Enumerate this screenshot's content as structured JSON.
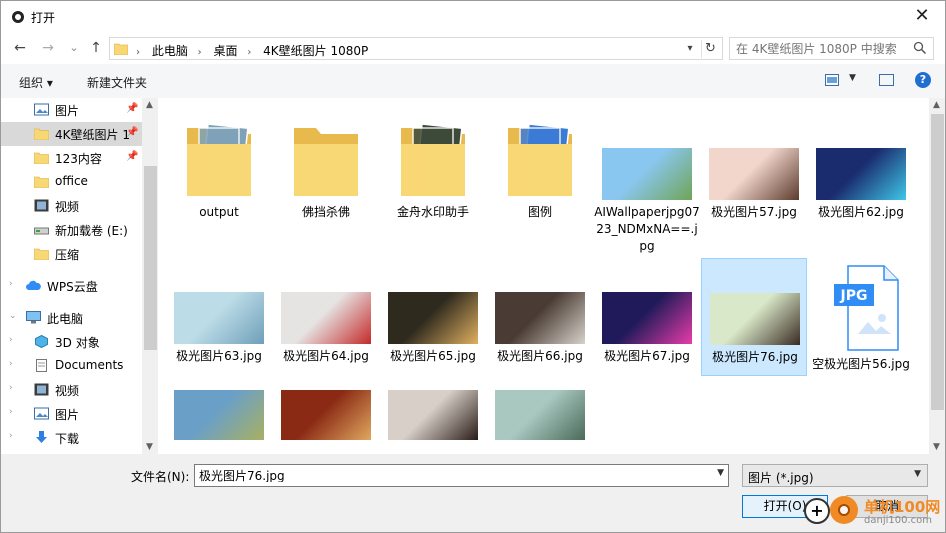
{
  "window": {
    "title": "打开",
    "close_glyph": "✕"
  },
  "nav": {
    "back": "←",
    "forward": "→",
    "recent": "⌄",
    "up": "↑",
    "breadcrumbs": [
      "此电脑",
      "桌面",
      "4K壁纸图片 1080P"
    ],
    "separator": "›",
    "search_placeholder": "在 4K壁纸图片 1080P 中搜索"
  },
  "toolbar": {
    "organize": "组织 ▾",
    "new_folder": "新建文件夹",
    "help": "?"
  },
  "sidebar": {
    "items": [
      {
        "label": "图片",
        "icon": "pictures-icon",
        "pinned": true
      },
      {
        "label": "4K壁纸图片 1",
        "icon": "folder-icon",
        "pinned": true,
        "selected": true
      },
      {
        "label": "123内容",
        "icon": "folder-icon",
        "pinned": true
      },
      {
        "label": "office",
        "icon": "folder-icon"
      },
      {
        "label": "视频",
        "icon": "video-icon"
      },
      {
        "label": "新加载卷 (E:)",
        "icon": "drive-icon"
      },
      {
        "label": "压缩",
        "icon": "folder-icon"
      },
      {
        "label": "WPS云盘",
        "icon": "cloud-icon"
      },
      {
        "label": "此电脑",
        "icon": "computer-icon"
      },
      {
        "label": "3D 对象",
        "icon": "3d-objects-icon"
      },
      {
        "label": "Documents",
        "icon": "documents-icon"
      },
      {
        "label": "视频",
        "icon": "video-icon"
      },
      {
        "label": "图片",
        "icon": "pictures-icon"
      },
      {
        "label": "下载",
        "icon": "download-icon"
      }
    ]
  },
  "files": [
    {
      "name": "output",
      "kind": "folder",
      "accent": "#7fa2b8"
    },
    {
      "name": "佛挡杀佛",
      "kind": "folder-empty"
    },
    {
      "name": "金舟水印助手",
      "kind": "folder",
      "accent": "#3d4a3a"
    },
    {
      "name": "图例",
      "kind": "folder",
      "accent": "#3b7bd6"
    },
    {
      "name": "AIWallpaperjpg0723_NDMxNA==.jpg",
      "kind": "image",
      "c1": "#8ac7f0",
      "c2": "#6fa457"
    },
    {
      "name": "极光图片57.jpg",
      "kind": "image",
      "c1": "#f2d6cc",
      "c2": "#5b3b2e"
    },
    {
      "name": "极光图片62.jpg",
      "kind": "image",
      "c1": "#1a2c6e",
      "c2": "#3fc7e8"
    },
    {
      "name": "极光图片63.jpg",
      "kind": "image",
      "c1": "#bcdce8",
      "c2": "#6f9fb8"
    },
    {
      "name": "极光图片64.jpg",
      "kind": "image",
      "c1": "#e6e3e3",
      "c2": "#c42a2a"
    },
    {
      "name": "极光图片65.jpg",
      "kind": "image",
      "c1": "#2e2a1e",
      "c2": "#e0b060"
    },
    {
      "name": "极光图片66.jpg",
      "kind": "image",
      "c1": "#4a3c34",
      "c2": "#d8d2cc"
    },
    {
      "name": "极光图片67.jpg",
      "kind": "image",
      "c1": "#201a5a",
      "c2": "#e83ca8"
    },
    {
      "name": "极光图片76.jpg",
      "kind": "image",
      "c1": "#d8e8c8",
      "c2": "#3a2a22",
      "selected": true
    },
    {
      "name": "空极光图片56.jpg",
      "kind": "jpg-icon",
      "badge": "JPG"
    },
    {
      "name": "",
      "kind": "image",
      "c1": "#6aa0c8",
      "c2": "#a8b060"
    },
    {
      "name": "",
      "kind": "image",
      "c1": "#8a2a14",
      "c2": "#e0a860"
    },
    {
      "name": "",
      "kind": "image",
      "c1": "#d8cfc8",
      "c2": "#2a1c18"
    },
    {
      "name": "",
      "kind": "image",
      "c1": "#a8c8c0",
      "c2": "#4a6a5a"
    }
  ],
  "footer": {
    "filename_label": "文件名(N):",
    "filename_value": "极光图片76.jpg",
    "filetype_value": "图片 (*.jpg)",
    "open_label": "打开(O)",
    "cancel_label": "取消"
  },
  "watermark": {
    "site": "单机100网",
    "url": "danji100.com"
  },
  "colors": {
    "accent": "#0078d7",
    "selection": "#cce8ff",
    "folder": "#f8d775"
  }
}
